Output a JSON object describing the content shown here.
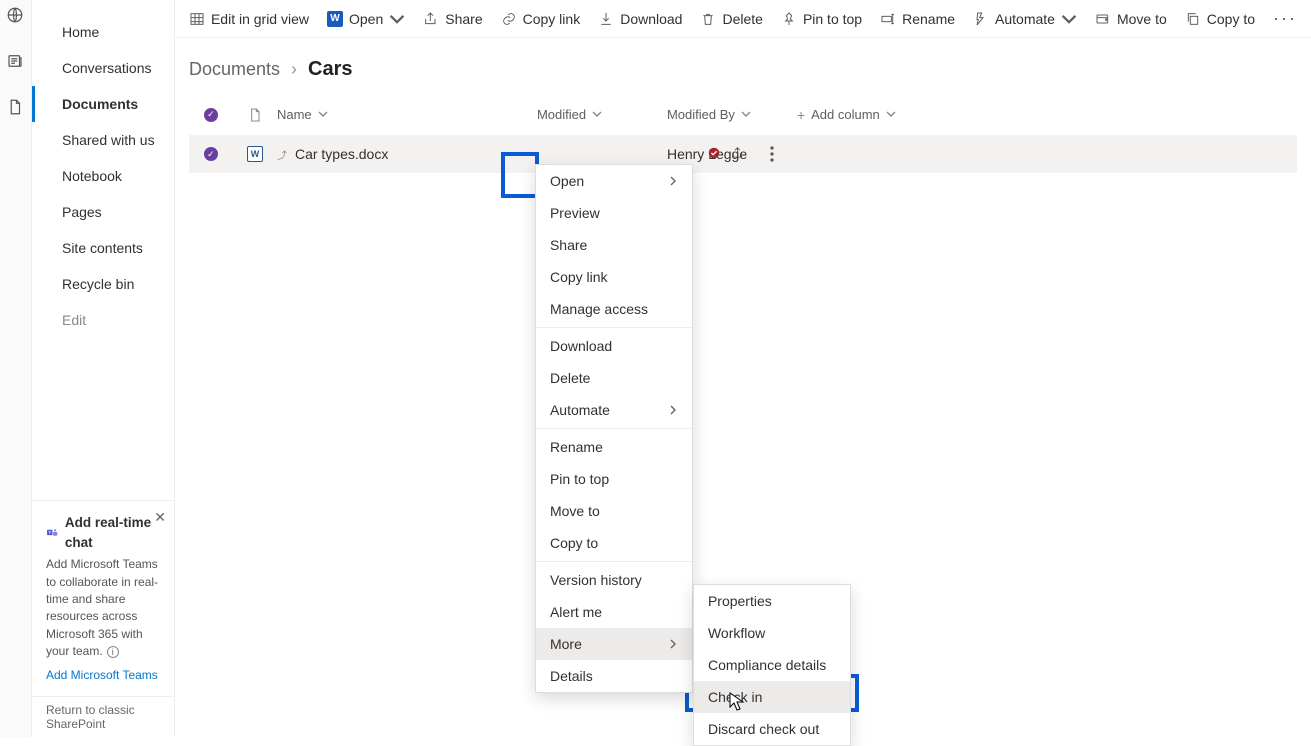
{
  "sidebar": {
    "items": [
      {
        "label": "Home"
      },
      {
        "label": "Conversations"
      },
      {
        "label": "Documents"
      },
      {
        "label": "Shared with us"
      },
      {
        "label": "Notebook"
      },
      {
        "label": "Pages"
      },
      {
        "label": "Site contents"
      },
      {
        "label": "Recycle bin"
      },
      {
        "label": "Edit"
      }
    ],
    "promo": {
      "title": "Add real-time chat",
      "body": "Add Microsoft Teams to collaborate in real-time and share resources across Microsoft 365 with your team.",
      "link": "Add Microsoft Teams"
    },
    "classic": "Return to classic SharePoint"
  },
  "toolbar": {
    "edit_grid": "Edit in grid view",
    "open": "Open",
    "share": "Share",
    "copy_link": "Copy link",
    "download": "Download",
    "delete": "Delete",
    "pin": "Pin to top",
    "rename": "Rename",
    "automate": "Automate",
    "move": "Move to",
    "copy": "Copy to"
  },
  "breadcrumb": {
    "parent": "Documents",
    "current": "Cars"
  },
  "columns": {
    "name": "Name",
    "modified": "Modified",
    "modified_by": "Modified By",
    "add": "Add column"
  },
  "row": {
    "filename": "Car types.docx",
    "modified_by": "Henry Legge"
  },
  "context": {
    "items": [
      "Open",
      "Preview",
      "Share",
      "Copy link",
      "Manage access",
      "_sep",
      "Download",
      "Delete",
      "Automate",
      "_sep",
      "Rename",
      "Pin to top",
      "Move to",
      "Copy to",
      "_sep",
      "Version history",
      "Alert me",
      "More",
      "Details"
    ],
    "submenu": [
      "Properties",
      "Workflow",
      "Compliance details",
      "Check in",
      "Discard check out"
    ]
  }
}
